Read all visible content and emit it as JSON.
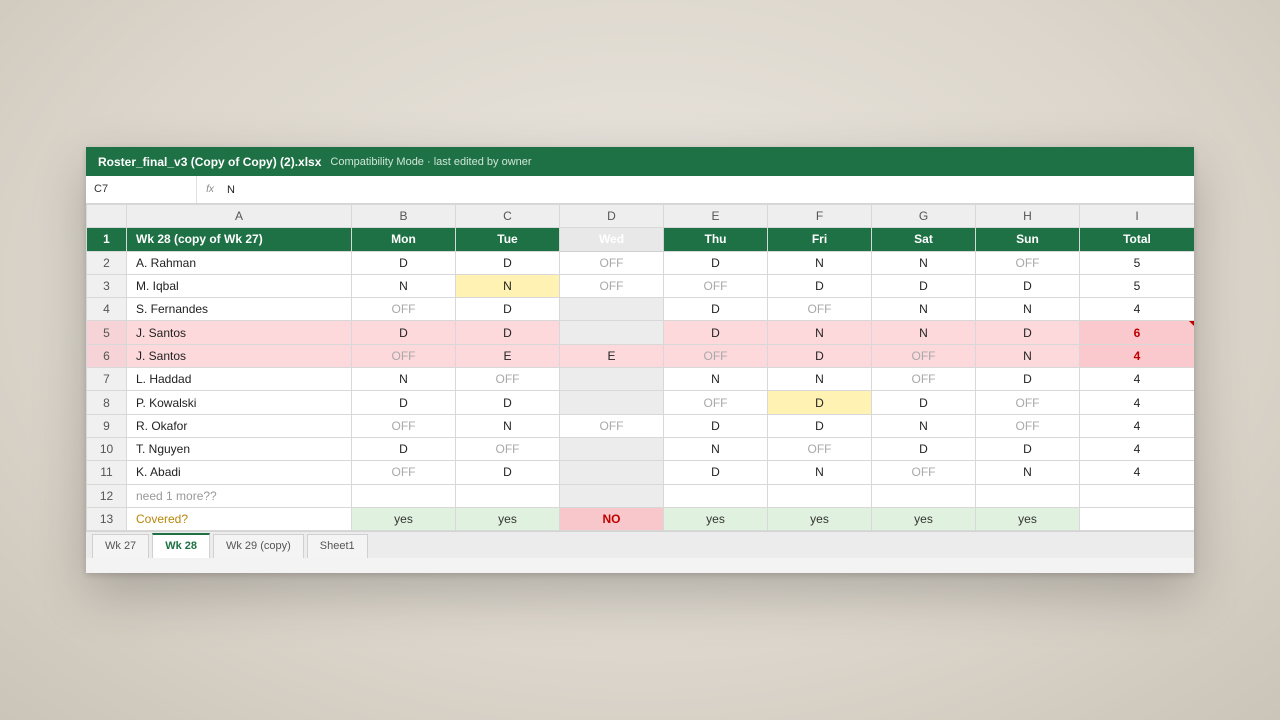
{
  "title": {
    "filename": "Roster_final_v3 (Copy of Copy) (2).xlsx",
    "meta": "Compatibility Mode · last edited by owner"
  },
  "formula_bar": {
    "cell_ref": "C7",
    "fx": "fx",
    "value": "N"
  },
  "columns": [
    "A",
    "B",
    "C",
    "D",
    "E",
    "F",
    "G",
    "H",
    "I"
  ],
  "header_row": {
    "num": "1",
    "title": "Wk 28 (copy of Wk 27)",
    "days": [
      "Mon",
      "Tue",
      "Wed",
      "Thu",
      "Fri",
      "Sat",
      "Sun"
    ],
    "total": "Total"
  },
  "rows": [
    {
      "num": "2",
      "name": "A. Rahman",
      "cells": [
        "D",
        "D",
        "OFF",
        "D",
        "N",
        "N",
        "OFF"
      ],
      "total": "5"
    },
    {
      "num": "3",
      "name": "M. Iqbal",
      "cells": [
        "N",
        "N",
        "OFF",
        "OFF",
        "D",
        "D",
        "D"
      ],
      "total": "5"
    },
    {
      "num": "4",
      "name": "S. Fernandes",
      "cells": [
        "OFF",
        "D",
        "",
        "D",
        "OFF",
        "N",
        "N"
      ],
      "total": "4"
    },
    {
      "num": "5",
      "name": "J. Santos",
      "cells": [
        "D",
        "D",
        "",
        "D",
        "N",
        "N",
        "D"
      ],
      "total": "6"
    },
    {
      "num": "6",
      "name": "J. Santos",
      "cells": [
        "OFF",
        "E",
        "E",
        "OFF",
        "D",
        "OFF",
        "N"
      ],
      "total": "4"
    },
    {
      "num": "7",
      "name": "L. Haddad",
      "cells": [
        "N",
        "OFF",
        "",
        "N",
        "N",
        "OFF",
        "D"
      ],
      "total": "4"
    },
    {
      "num": "8",
      "name": "P. Kowalski",
      "cells": [
        "D",
        "D",
        "",
        "OFF",
        "D",
        "D",
        "OFF"
      ],
      "total": "4"
    },
    {
      "num": "9",
      "name": "R. Okafor",
      "cells": [
        "OFF",
        "N",
        "OFF",
        "D",
        "D",
        "N",
        "OFF"
      ],
      "total": "4"
    },
    {
      "num": "10",
      "name": "T. Nguyen",
      "cells": [
        "D",
        "OFF",
        "",
        "N",
        "OFF",
        "D",
        "D"
      ],
      "total": "4"
    },
    {
      "num": "11",
      "name": "K. Abadi",
      "cells": [
        "OFF",
        "D",
        "",
        "D",
        "N",
        "OFF",
        "N"
      ],
      "total": "4"
    }
  ],
  "note_row": {
    "num": "12",
    "text": "need 1 more??"
  },
  "covered_row": {
    "num": "13",
    "label": "Covered?",
    "values": [
      "yes",
      "yes",
      "NO",
      "yes",
      "yes",
      "yes",
      "yes"
    ]
  },
  "sheet_tabs": [
    {
      "label": "Wk 27",
      "active": false
    },
    {
      "label": "Wk 28",
      "active": true
    },
    {
      "label": "Wk 29 (copy)",
      "active": false
    },
    {
      "label": "Sheet1",
      "active": false
    }
  ],
  "colors": {
    "brand_green": "#1e7145",
    "duplicate_highlight": "#fdd9dc",
    "yellow_highlight": "#fff2b3",
    "covered_yes": "#e0f1df",
    "covered_no": "#f7c7cb"
  }
}
